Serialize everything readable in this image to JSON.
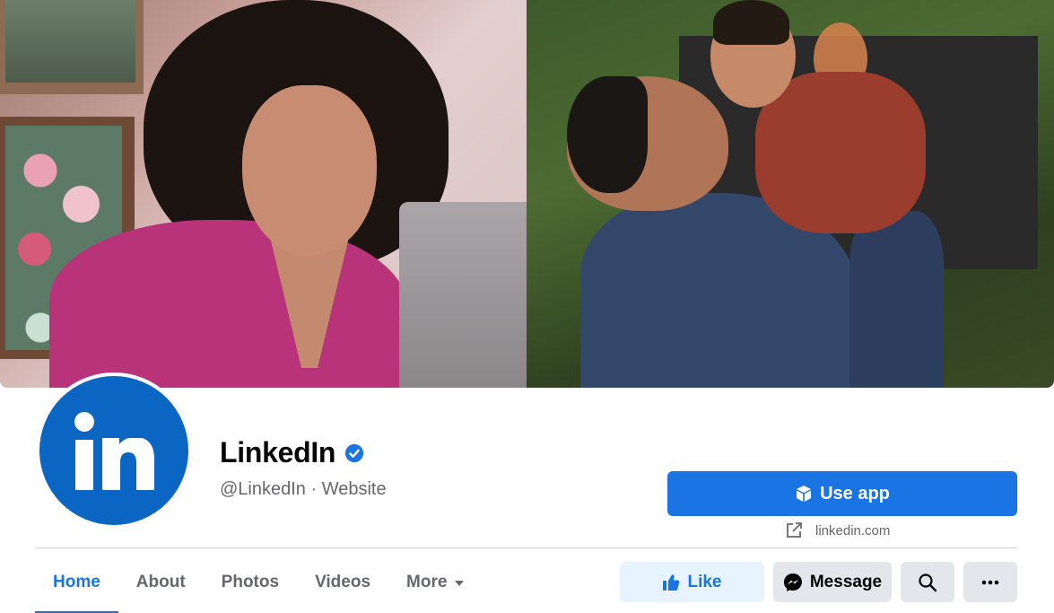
{
  "page": {
    "name": "LinkedIn",
    "handle": "@LinkedIn",
    "separator": "·",
    "category": "Website",
    "subtitle": "@LinkedIn · Website",
    "verified": true
  },
  "actions": {
    "use_app_label": "Use app",
    "website_link": "linkedin.com",
    "like_label": "Like",
    "message_label": "Message"
  },
  "tabs": [
    {
      "label": "Home",
      "active": true
    },
    {
      "label": "About",
      "active": false
    },
    {
      "label": "Photos",
      "active": false
    },
    {
      "label": "Videos",
      "active": false
    },
    {
      "label": "More",
      "active": false,
      "has_dropdown": true
    }
  ],
  "icons": {
    "verified": "verified-badge-icon",
    "use_app": "cube-icon",
    "website": "external-link-icon",
    "like": "thumbs-up-icon",
    "message": "messenger-icon",
    "search": "search-icon",
    "more": "ellipsis-icon"
  },
  "colors": {
    "accent": "#1b74e4",
    "linkedin_blue": "#0a66c2",
    "secondary_text": "#65676b",
    "button_gray": "#e4e6eb",
    "like_bg": "#e7f3ff"
  }
}
